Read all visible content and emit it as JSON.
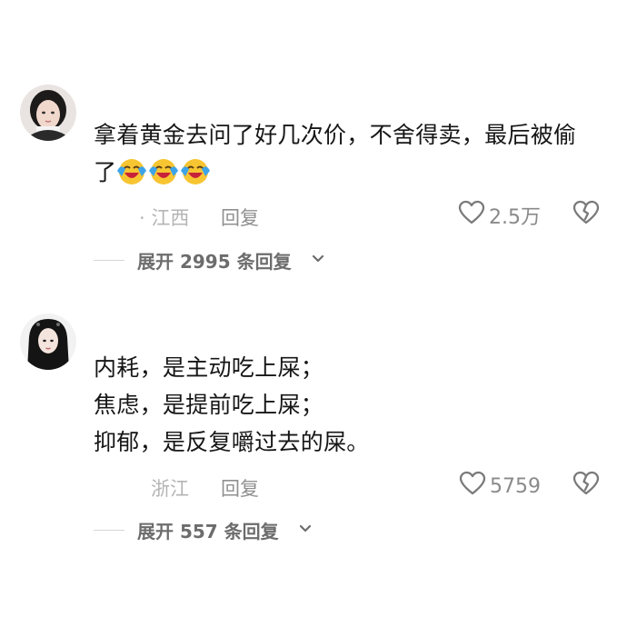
{
  "comments": [
    {
      "text_lines": [
        "拿着黄金去问了好几次价，不舍得卖，最后被偷",
        "了"
      ],
      "emojis": [
        "crying-laugh-emoji",
        "crying-laugh-emoji",
        "crying-laugh-emoji"
      ],
      "location": "· 江西",
      "reply_label": "回复",
      "like_count": "2.5万",
      "expand_label": "展开 2995 条回复"
    },
    {
      "text_lines": [
        "内耗，是主动吃上屎；",
        "焦虑，是提前吃上屎；",
        "抑郁，是反复嚼过去的屎。"
      ],
      "location": "浙江",
      "reply_label": "回复",
      "like_count": "5759",
      "expand_label": "展开 557 条回复"
    }
  ],
  "icons": {
    "like": "heart-outline-icon",
    "dislike": "broken-heart-icon",
    "expand": "chevron-down-icon"
  },
  "colors": {
    "text": "#161616",
    "meta": "#9a9a9a",
    "emoji_face": "#f7c531",
    "emoji_tear": "#3da4ea",
    "emoji_mouth": "#c8213a"
  }
}
